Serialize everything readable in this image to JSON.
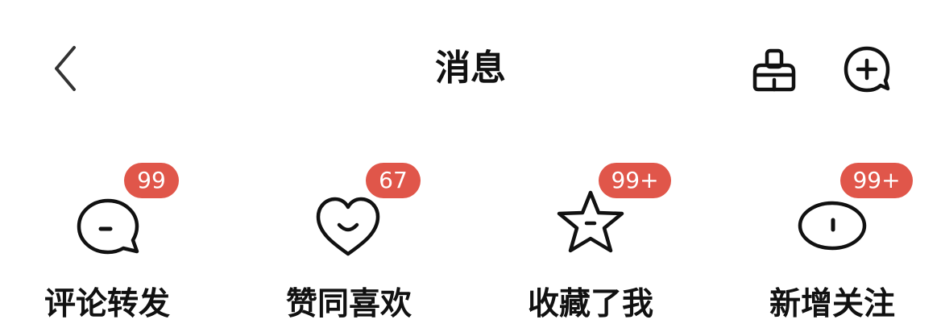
{
  "header": {
    "title": "消息",
    "back_icon": "chevron-left-icon",
    "cleanup_icon": "broom-icon",
    "add_icon": "chat-add-icon"
  },
  "categories": [
    {
      "label": "评论转发",
      "badge": "99",
      "icon": "comment-bubble-icon"
    },
    {
      "label": "赞同喜欢",
      "badge": "67",
      "icon": "heart-icon"
    },
    {
      "label": "收藏了我",
      "badge": "99+",
      "icon": "star-icon"
    },
    {
      "label": "新增关注",
      "badge": "99+",
      "icon": "follow-oval-icon"
    }
  ],
  "colors": {
    "badge_bg": "#e0564a",
    "text": "#111111",
    "icon_stroke": "#111111"
  }
}
